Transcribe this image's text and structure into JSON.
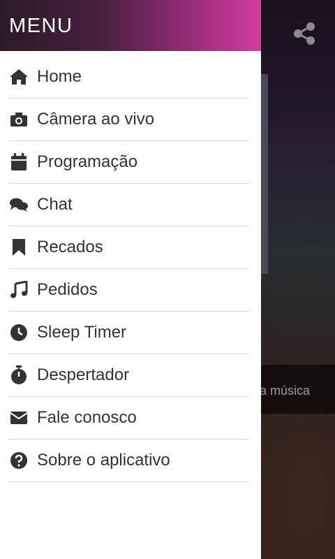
{
  "drawer": {
    "title": "MENU",
    "items": [
      {
        "label": "Home",
        "icon": "home-icon"
      },
      {
        "label": "Câmera ao vivo",
        "icon": "camera-icon"
      },
      {
        "label": "Programação",
        "icon": "calendar-icon"
      },
      {
        "label": "Chat",
        "icon": "chat-icon"
      },
      {
        "label": "Recados",
        "icon": "bookmark-icon"
      },
      {
        "label": "Pedidos",
        "icon": "music-note-icon"
      },
      {
        "label": "Sleep Timer",
        "icon": "clock-icon"
      },
      {
        "label": "Despertador",
        "icon": "stopwatch-icon"
      },
      {
        "label": "Fale conosco",
        "icon": "envelope-icon"
      },
      {
        "label": "Sobre o aplicativo",
        "icon": "question-circle-icon"
      }
    ]
  },
  "background": {
    "track_text": "a música",
    "share_icon": "share-icon"
  },
  "colors": {
    "header_gradient_start": "#2a1a26",
    "header_gradient_end": "#d33c9c",
    "text": "#333333",
    "divider": "#d9d9d9"
  }
}
